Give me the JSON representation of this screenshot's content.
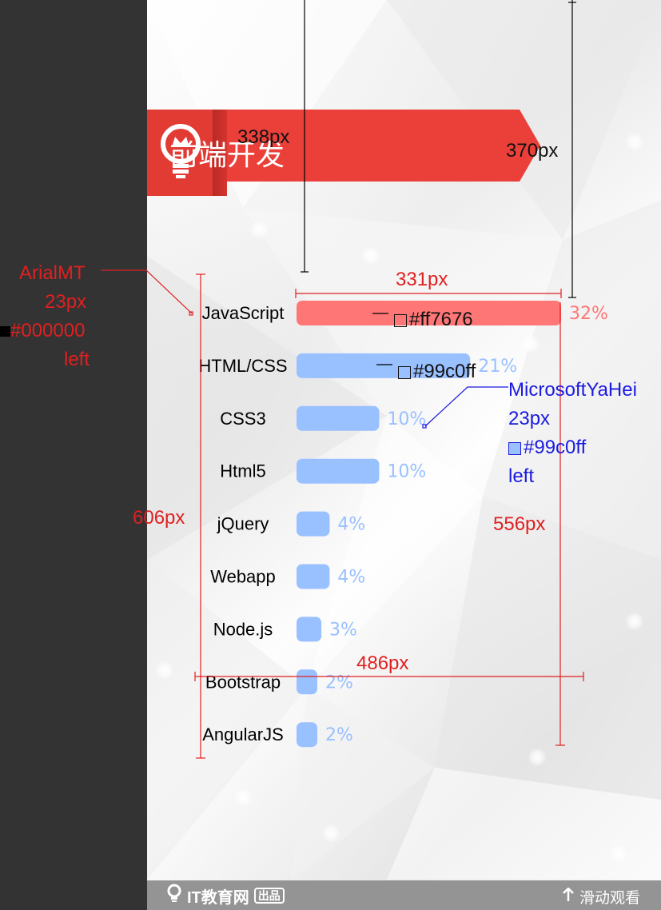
{
  "header": {
    "title": "前端开发"
  },
  "chart_data": {
    "type": "bar",
    "orientation": "horizontal",
    "categories": [
      "JavaScript",
      "HTML/CSS",
      "CSS3",
      "Html5",
      "jQuery",
      "Webapp",
      "Node.js",
      "Bootstrap",
      "AngularJS"
    ],
    "values": [
      32,
      21,
      10,
      10,
      4,
      4,
      3,
      2,
      2
    ],
    "labels": [
      "32%",
      "21%",
      "10%",
      "10%",
      "4%",
      "4%",
      "3%",
      "2%",
      "2%"
    ],
    "colors": {
      "highlight": "#ff7676",
      "normal": "#99c0ff"
    }
  },
  "annotations": {
    "left_font": [
      "ArialMT",
      "23px",
      "#000000",
      "left"
    ],
    "right_font": [
      "MicrosoftYaHei",
      "23px",
      "#99c0ff",
      "left"
    ],
    "dims": {
      "d338": "338px",
      "d370": "370px",
      "d331": "331px",
      "d606": "606px",
      "d556": "556px",
      "d486": "486px"
    },
    "swatch_red": "#ff7676",
    "swatch_blue": "#99c0ff"
  },
  "footer": {
    "brand": "IT教育网",
    "badge": "出品",
    "hint": "滑动观看"
  }
}
